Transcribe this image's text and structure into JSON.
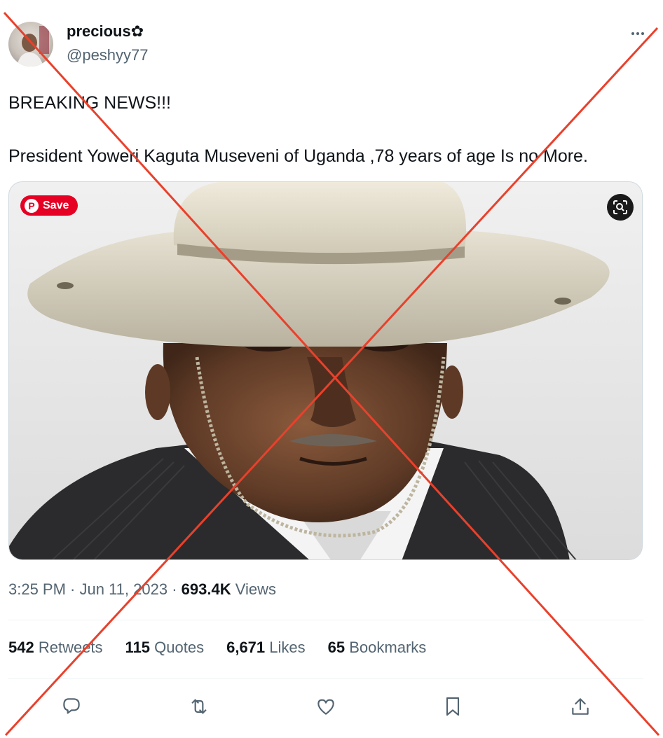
{
  "author": {
    "display_name": "precious✿",
    "handle": "@peshyy77"
  },
  "tweet": {
    "text": "BREAKING NEWS!!!\n\nPresident Yoweri Kaguta Museveni of Uganda ,78 years of age Is no More."
  },
  "media": {
    "save_label": "Save",
    "pin_glyph": "P",
    "lens_icon": "lens-icon"
  },
  "meta": {
    "time": "3:25 PM",
    "sep1": " · ",
    "date": "Jun 11, 2023",
    "sep2": " · ",
    "views_count": "693.4K",
    "views_label": " Views"
  },
  "stats": {
    "retweets": {
      "count": "542",
      "label": " Retweets"
    },
    "quotes": {
      "count": "115",
      "label": " Quotes"
    },
    "likes": {
      "count": "6,671",
      "label": " Likes"
    },
    "bookmarks": {
      "count": "65",
      "label": " Bookmarks"
    }
  },
  "actions": [
    "reply-icon",
    "retweet-icon",
    "like-icon",
    "bookmark-icon",
    "share-icon"
  ],
  "colors": {
    "overlay_x": "#e8412c",
    "pinterest": "#e60023",
    "secondary_text": "#536471"
  }
}
